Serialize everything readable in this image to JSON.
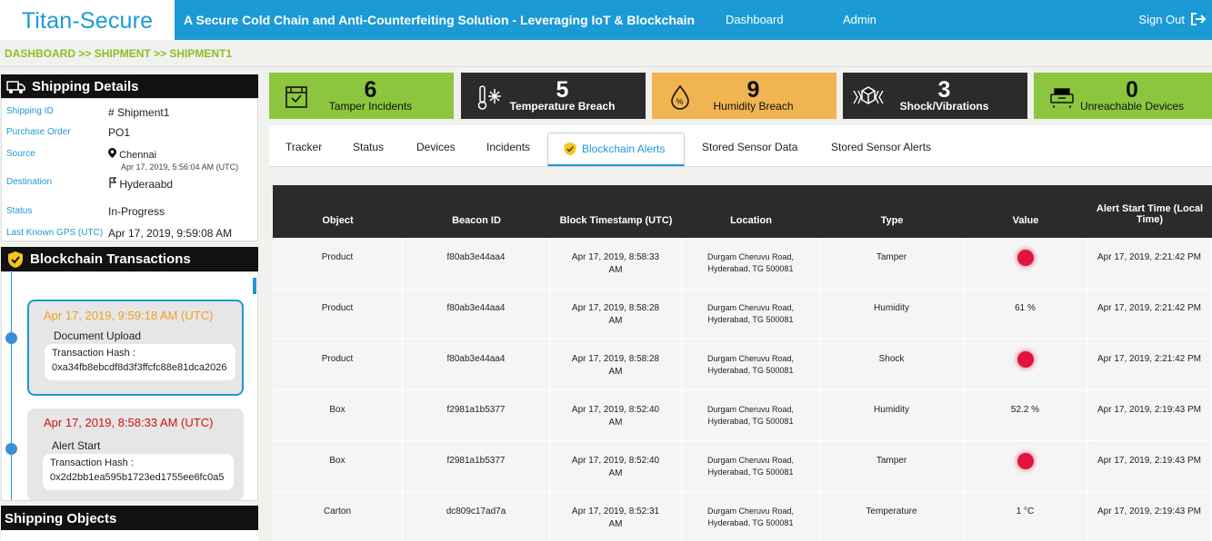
{
  "header": {
    "brand": "Titan-Secure",
    "tagline": "A Secure Cold Chain and Anti-Counterfeiting Solution - Leveraging IoT & Blockchain",
    "nav": [
      "Dashboard",
      "Admin"
    ],
    "signout_label": "Sign Out",
    "color": "#1b9ad6"
  },
  "breadcrumb": "DASHBOARD >> SHIPMENT >> SHIPMENT1",
  "shipping_details": {
    "title": "Shipping Details",
    "shipping_id_label": "Shipping ID",
    "shipping_id": "# Shipment1",
    "po_label": "Purchase Order",
    "po": "PO1",
    "source_label": "Source",
    "source": "Chennai",
    "source_time": "Apr 17, 2019, 5:56:04 AM (UTC)",
    "destination_label": "Destination",
    "destination": "Hyderaabd",
    "status_label": "Status",
    "status": "In-Progress",
    "gps_label": "Last Known GPS (UTC)",
    "gps": "Apr 17, 2019, 9:59:08 AM"
  },
  "blockchain": {
    "title": "Blockchain Transactions",
    "transactions": [
      {
        "time": "Apr 17, 2019, 9:59:18 AM (UTC)",
        "title": "Document Upload",
        "hash_label": "Transaction Hash :",
        "hash": "0xa34fb8ebcdf8d3f3ffcfc88e81dca2026",
        "time_color": "#f0a020"
      },
      {
        "time": "Apr 17, 2019, 8:58:33 AM (UTC)",
        "title": "Alert Start",
        "hash_label": "Transaction Hash :",
        "hash": "0x2d2bb1ea595b1723ed1755ee6fc0a5",
        "time_color": "#d01010"
      }
    ]
  },
  "shipping_objects_title": "Shipping Objects",
  "stats": [
    {
      "value": "6",
      "label": "Tamper Incidents",
      "bg": "#8cc63f",
      "fg": "#111",
      "icon": "tamper-box-icon"
    },
    {
      "value": "5",
      "label": "Temperature Breach",
      "bg": "#2b2b2b",
      "fg": "#fff",
      "icon": "thermometer-snowflake-icon"
    },
    {
      "value": "9",
      "label": "Humidity Breach",
      "bg": "#f0b450",
      "fg": "#111",
      "icon": "humidity-drop-icon"
    },
    {
      "value": "3",
      "label": "Shock/Vibrations",
      "bg": "#2b2b2b",
      "fg": "#fff",
      "icon": "shock-box-icon"
    },
    {
      "value": "0",
      "label": "Unreachable Devices",
      "bg": "#8cc63f",
      "fg": "#111",
      "icon": "unreachable-device-icon"
    }
  ],
  "tabs": [
    "Tracker",
    "Status",
    "Devices",
    "Incidents",
    "Blockchain Alerts",
    "Stored Sensor Data",
    "Stored Sensor Alerts"
  ],
  "active_tab": "Blockchain Alerts",
  "table": {
    "headers": [
      "Object",
      "Beacon ID",
      "Block Timestamp (UTC)",
      "Location",
      "Type",
      "Value",
      "Alert Start Time (Local Time)"
    ],
    "rows": [
      {
        "object": "Product",
        "beacon": "f80ab3e44aa4",
        "ts1": "Apr 17, 2019, 8:58:33",
        "ts2": "AM",
        "loc1": "Durgam Cheruvu Road,",
        "loc2": "Hyderabad, TG 500081",
        "type": "Tamper",
        "value": "",
        "indicator": true,
        "start": "Apr 17, 2019, 2:21:42 PM"
      },
      {
        "object": "Product",
        "beacon": "f80ab3e44aa4",
        "ts1": "Apr 17, 2019, 8:58:28",
        "ts2": "AM",
        "loc1": "Durgam Cheruvu Road,",
        "loc2": "Hyderabad, TG 500081",
        "type": "Humidity",
        "value": "61 %",
        "indicator": false,
        "start": "Apr 17, 2019, 2:21:42 PM"
      },
      {
        "object": "Product",
        "beacon": "f80ab3e44aa4",
        "ts1": "Apr 17, 2019, 8:58:28",
        "ts2": "AM",
        "loc1": "Durgam Cheruvu Road,",
        "loc2": "Hyderabad, TG 500081",
        "type": "Shock",
        "value": "",
        "indicator": true,
        "start": "Apr 17, 2019, 2:21:42 PM"
      },
      {
        "object": "Box",
        "beacon": "f2981a1b5377",
        "ts1": "Apr 17, 2019, 8:52:40",
        "ts2": "AM",
        "loc1": "Durgam Cheruvu Road,",
        "loc2": "Hyderabad, TG 500081",
        "type": "Humidity",
        "value": "52.2 %",
        "indicator": false,
        "start": "Apr 17, 2019, 2:19:43 PM"
      },
      {
        "object": "Box",
        "beacon": "f2981a1b5377",
        "ts1": "Apr 17, 2019, 8:52:40",
        "ts2": "AM",
        "loc1": "Durgam Cheruvu Road,",
        "loc2": "Hyderabad, TG 500081",
        "type": "Tamper",
        "value": "",
        "indicator": true,
        "start": "Apr 17, 2019, 2:19:43 PM"
      },
      {
        "object": "Carton",
        "beacon": "dc809c17ad7a",
        "ts1": "Apr 17, 2019, 8:52:31",
        "ts2": "AM",
        "loc1": "Durgam Cheruvu Road,",
        "loc2": "Hyderabad, TG 500081",
        "type": "Temperature",
        "value": "1 °C",
        "indicator": false,
        "start": "Apr 17, 2019, 2:19:43 PM"
      }
    ]
  }
}
